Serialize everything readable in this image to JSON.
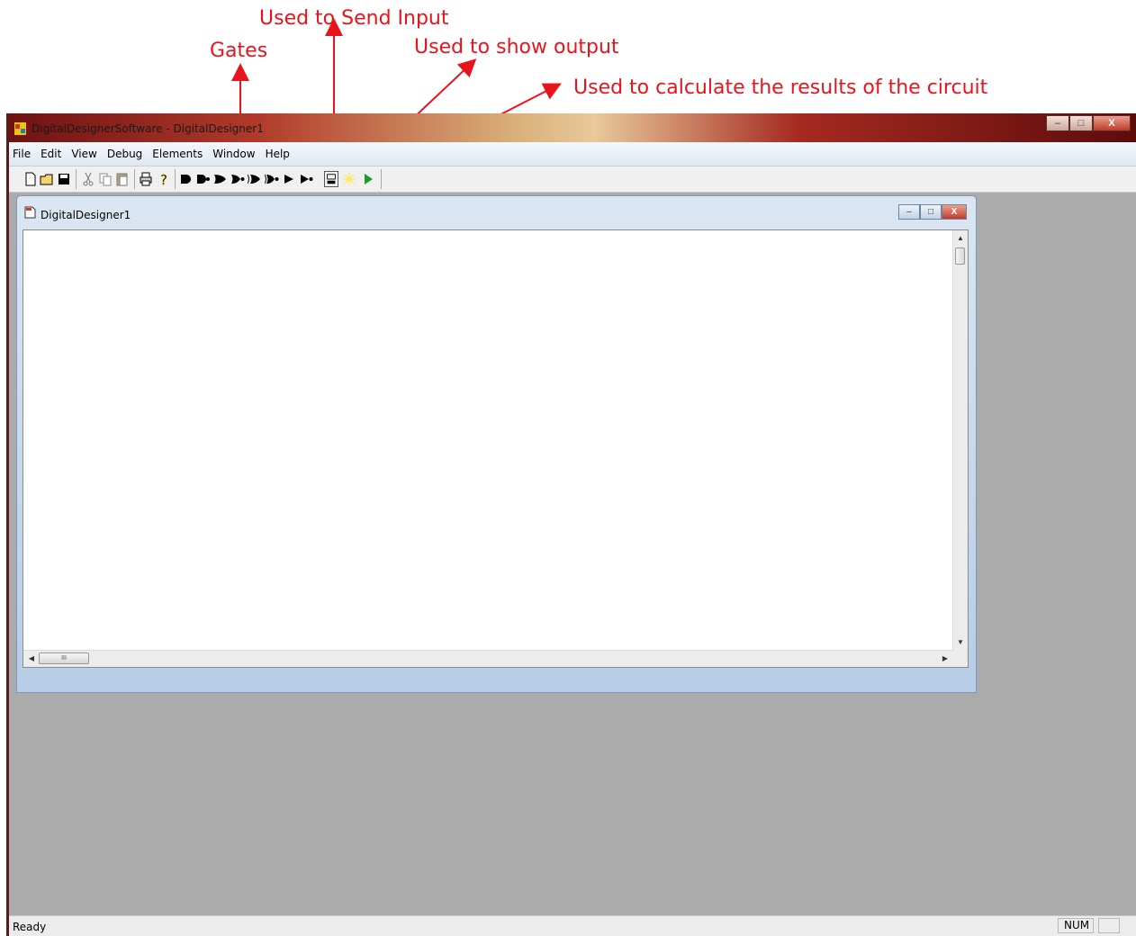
{
  "annotations": {
    "send_input": "Used to Send Input",
    "gates": "Gates",
    "show_output": "Used to show output",
    "calculate": "Used to calculate the results of the circuit",
    "color": "#e8141c"
  },
  "window": {
    "title": "DigitalDesignerSoftware - DigitalDesigner1",
    "minimize": "–",
    "maximize": "□",
    "close": "X"
  },
  "menu": {
    "items": [
      "File",
      "Edit",
      "View",
      "Debug",
      "Elements",
      "Window",
      "Help"
    ]
  },
  "toolbar": {
    "icons": {
      "new": "new-document-icon",
      "open": "open-folder-icon",
      "save": "save-icon",
      "cut": "cut-icon",
      "copy": "copy-icon",
      "paste": "paste-icon",
      "print": "print-icon",
      "help": "help-icon",
      "gates": [
        "and-gate-icon",
        "nand-gate-icon",
        "or-gate-icon",
        "nor-gate-icon",
        "xor-gate-icon",
        "xnor-gate-icon",
        "buffer-gate-icon",
        "not-gate-icon"
      ],
      "input": "input-switch-icon",
      "output": "output-lamp-icon",
      "run": "run-icon"
    }
  },
  "child_window": {
    "title": "DigitalDesigner1",
    "minimize": "–",
    "maximize": "□",
    "close": "X"
  },
  "scrollbar": {
    "h_thumb_grip": "III"
  },
  "status_bar": {
    "text": "Ready",
    "indicator": "NUM"
  }
}
